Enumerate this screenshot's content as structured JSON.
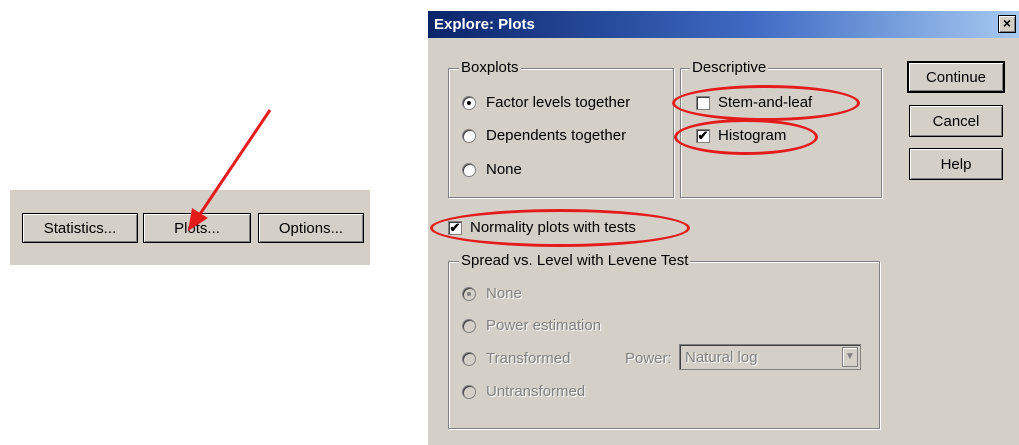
{
  "left_buttons": {
    "statistics": "Statistics...",
    "plots": "Plots...",
    "options": "Options..."
  },
  "dialog": {
    "title": "Explore: Plots",
    "close": "×",
    "boxplots": {
      "label": "Boxplots",
      "options": [
        "Factor levels together",
        "Dependents together",
        "None"
      ],
      "selected": 0
    },
    "descriptive": {
      "label": "Descriptive",
      "stem_and_leaf": "Stem-and-leaf",
      "stem_and_leaf_checked": false,
      "histogram": "Histogram",
      "histogram_checked": true
    },
    "normality": {
      "label": "Normality plots with tests",
      "checked": true
    },
    "spread": {
      "label": "Spread vs. Level with Levene Test",
      "options": [
        "None",
        "Power estimation",
        "Transformed",
        "Untransformed"
      ],
      "selected": 0,
      "power_label": "Power:",
      "power_value": "Natural log"
    },
    "buttons": {
      "continue": "Continue",
      "cancel": "Cancel",
      "help": "Help"
    }
  },
  "annotations": {
    "arrow_color": "#e41b1b",
    "ellipse_color": "#e41b1b"
  }
}
